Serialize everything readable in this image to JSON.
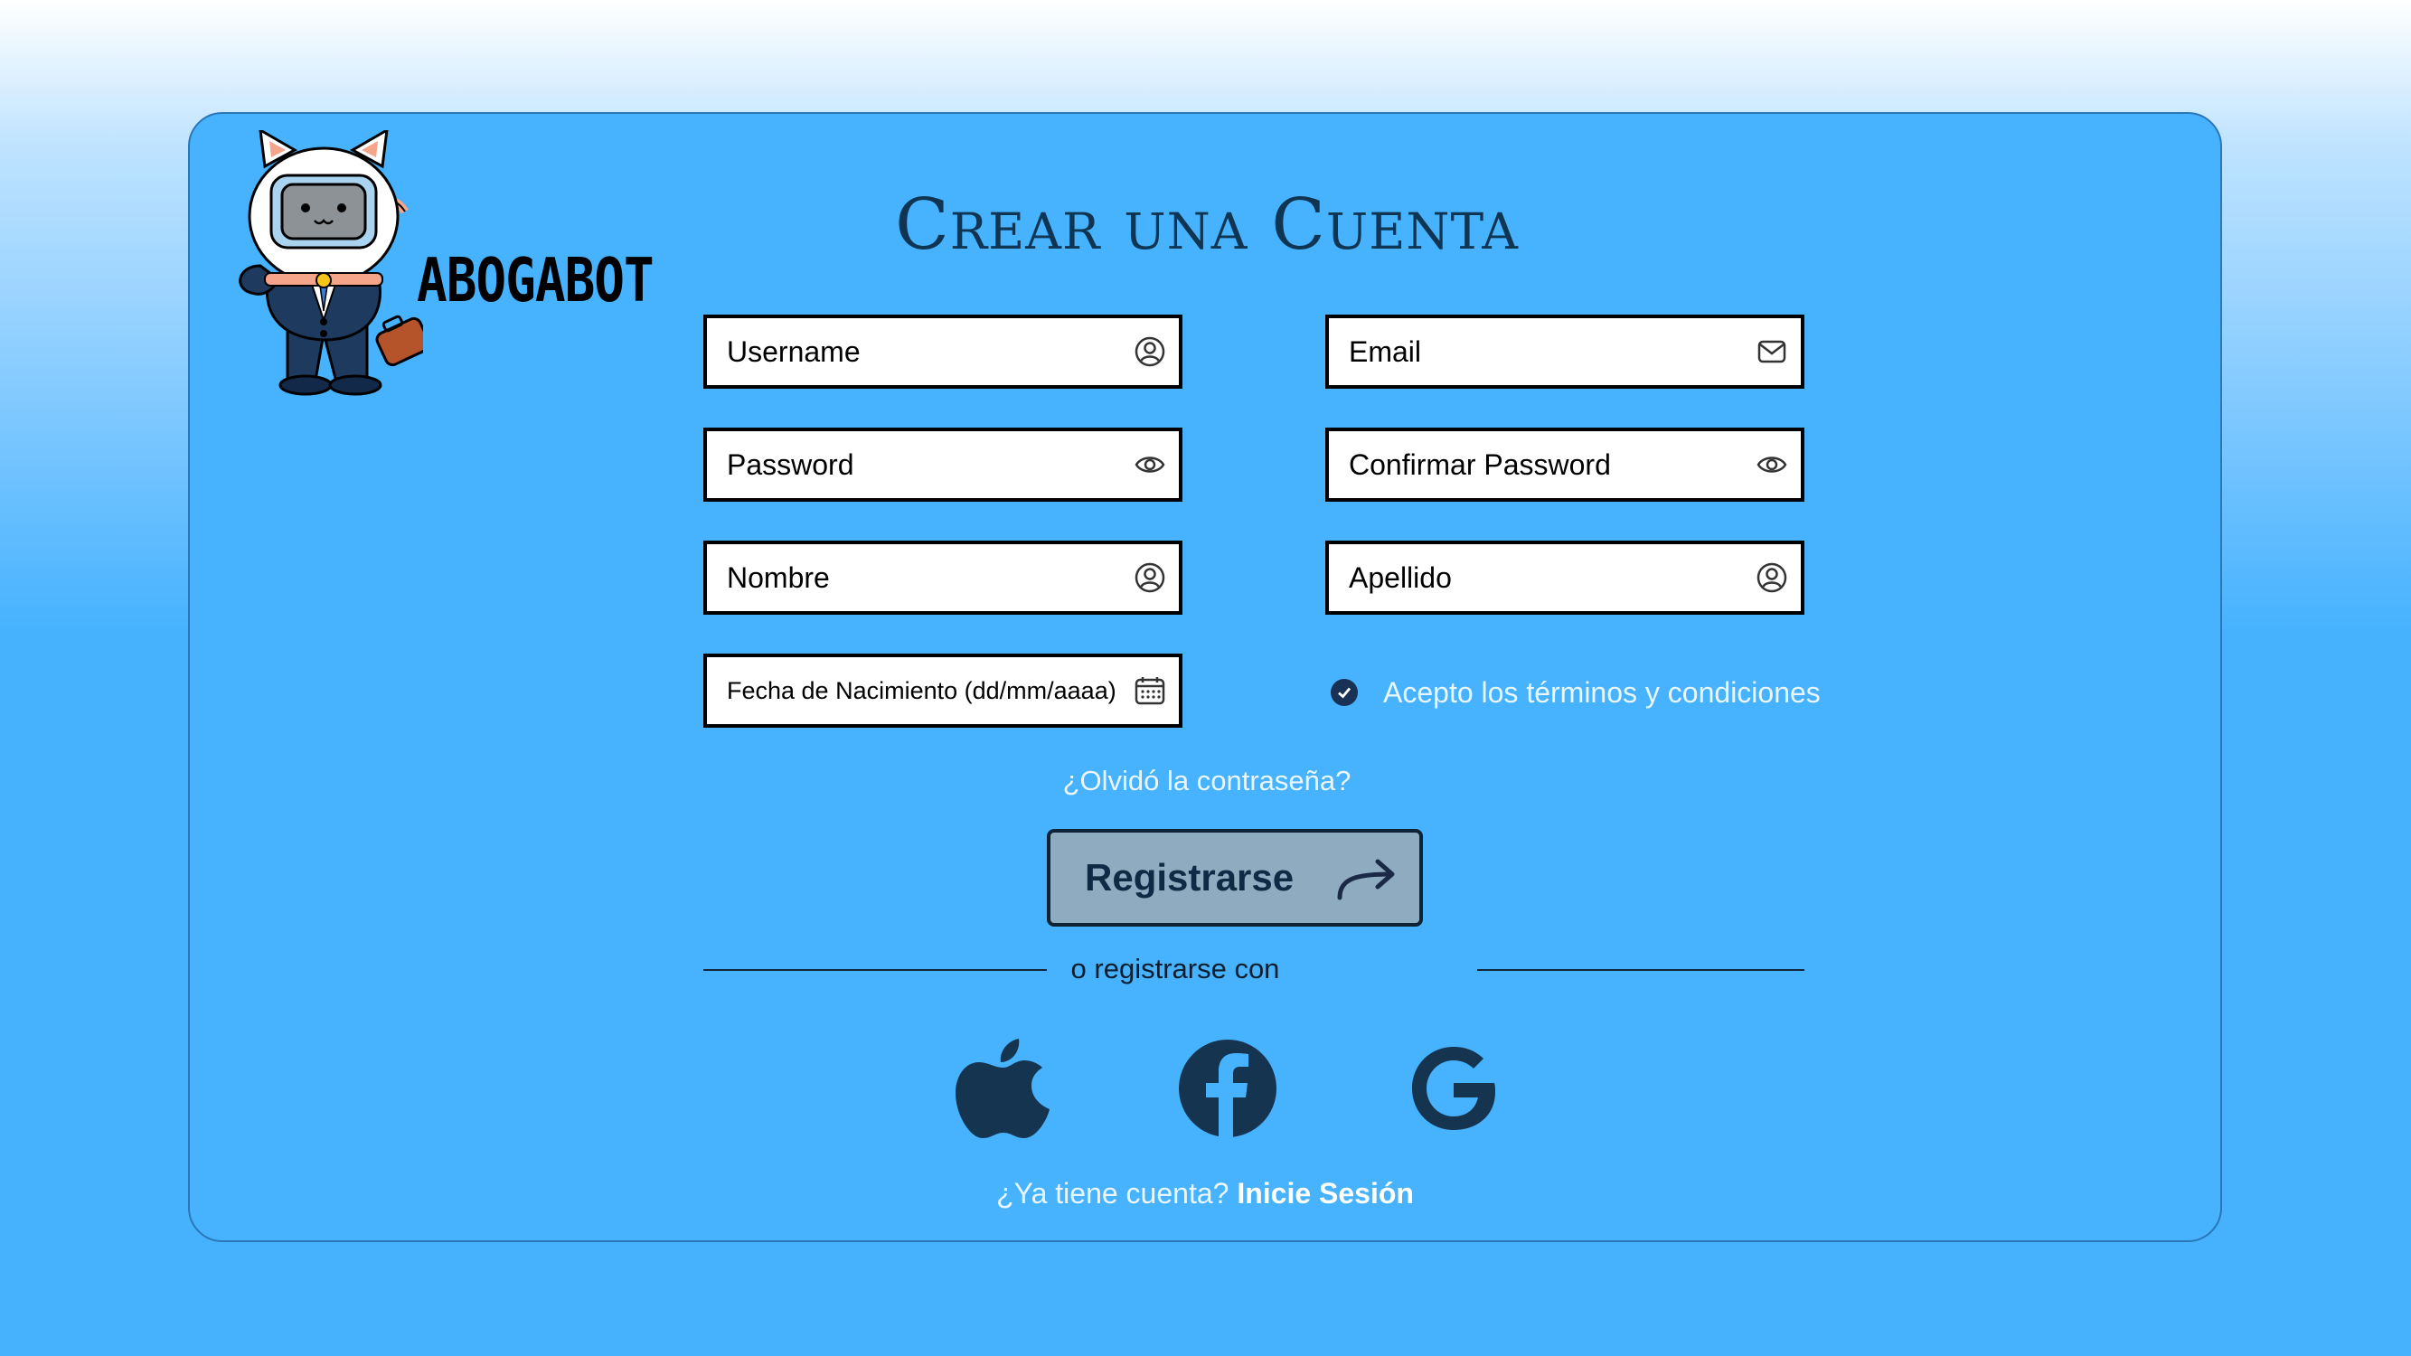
{
  "brand": {
    "name": "ABOGABOT"
  },
  "page": {
    "title": "Crear una Cuenta"
  },
  "form": {
    "username": {
      "placeholder": "Username",
      "icon": "user-circle-icon"
    },
    "email": {
      "placeholder": "Email",
      "icon": "envelope-icon"
    },
    "password": {
      "placeholder": "Password",
      "icon": "eye-icon"
    },
    "confirm_password": {
      "placeholder": "Confirmar Password",
      "icon": "eye-icon"
    },
    "nombre": {
      "placeholder": "Nombre",
      "icon": "user-circle-icon"
    },
    "apellido": {
      "placeholder": "Apellido",
      "icon": "user-circle-icon"
    },
    "birthdate": {
      "placeholder": "Fecha de Nacimiento (dd/mm/aaaa)",
      "icon": "calendar-icon"
    },
    "terms": {
      "label": "Acepto los términos y condiciones",
      "checked": true
    }
  },
  "forgot_password": "¿Olvidó la contraseña?",
  "register_button": {
    "label": "Registrarse",
    "icon": "arrow-right-icon"
  },
  "divider_text": "o registrarse con",
  "social_buttons": [
    "apple-icon",
    "facebook-icon",
    "google-icon"
  ],
  "login_prompt": {
    "text": "¿Ya tiene cuenta?",
    "link": "Inicie Sesión"
  },
  "colors": {
    "card_background": "#47b3fe",
    "accent_dark": "#0f3552",
    "button_background": "#8fabbf",
    "checkbox": "#1a3156"
  }
}
